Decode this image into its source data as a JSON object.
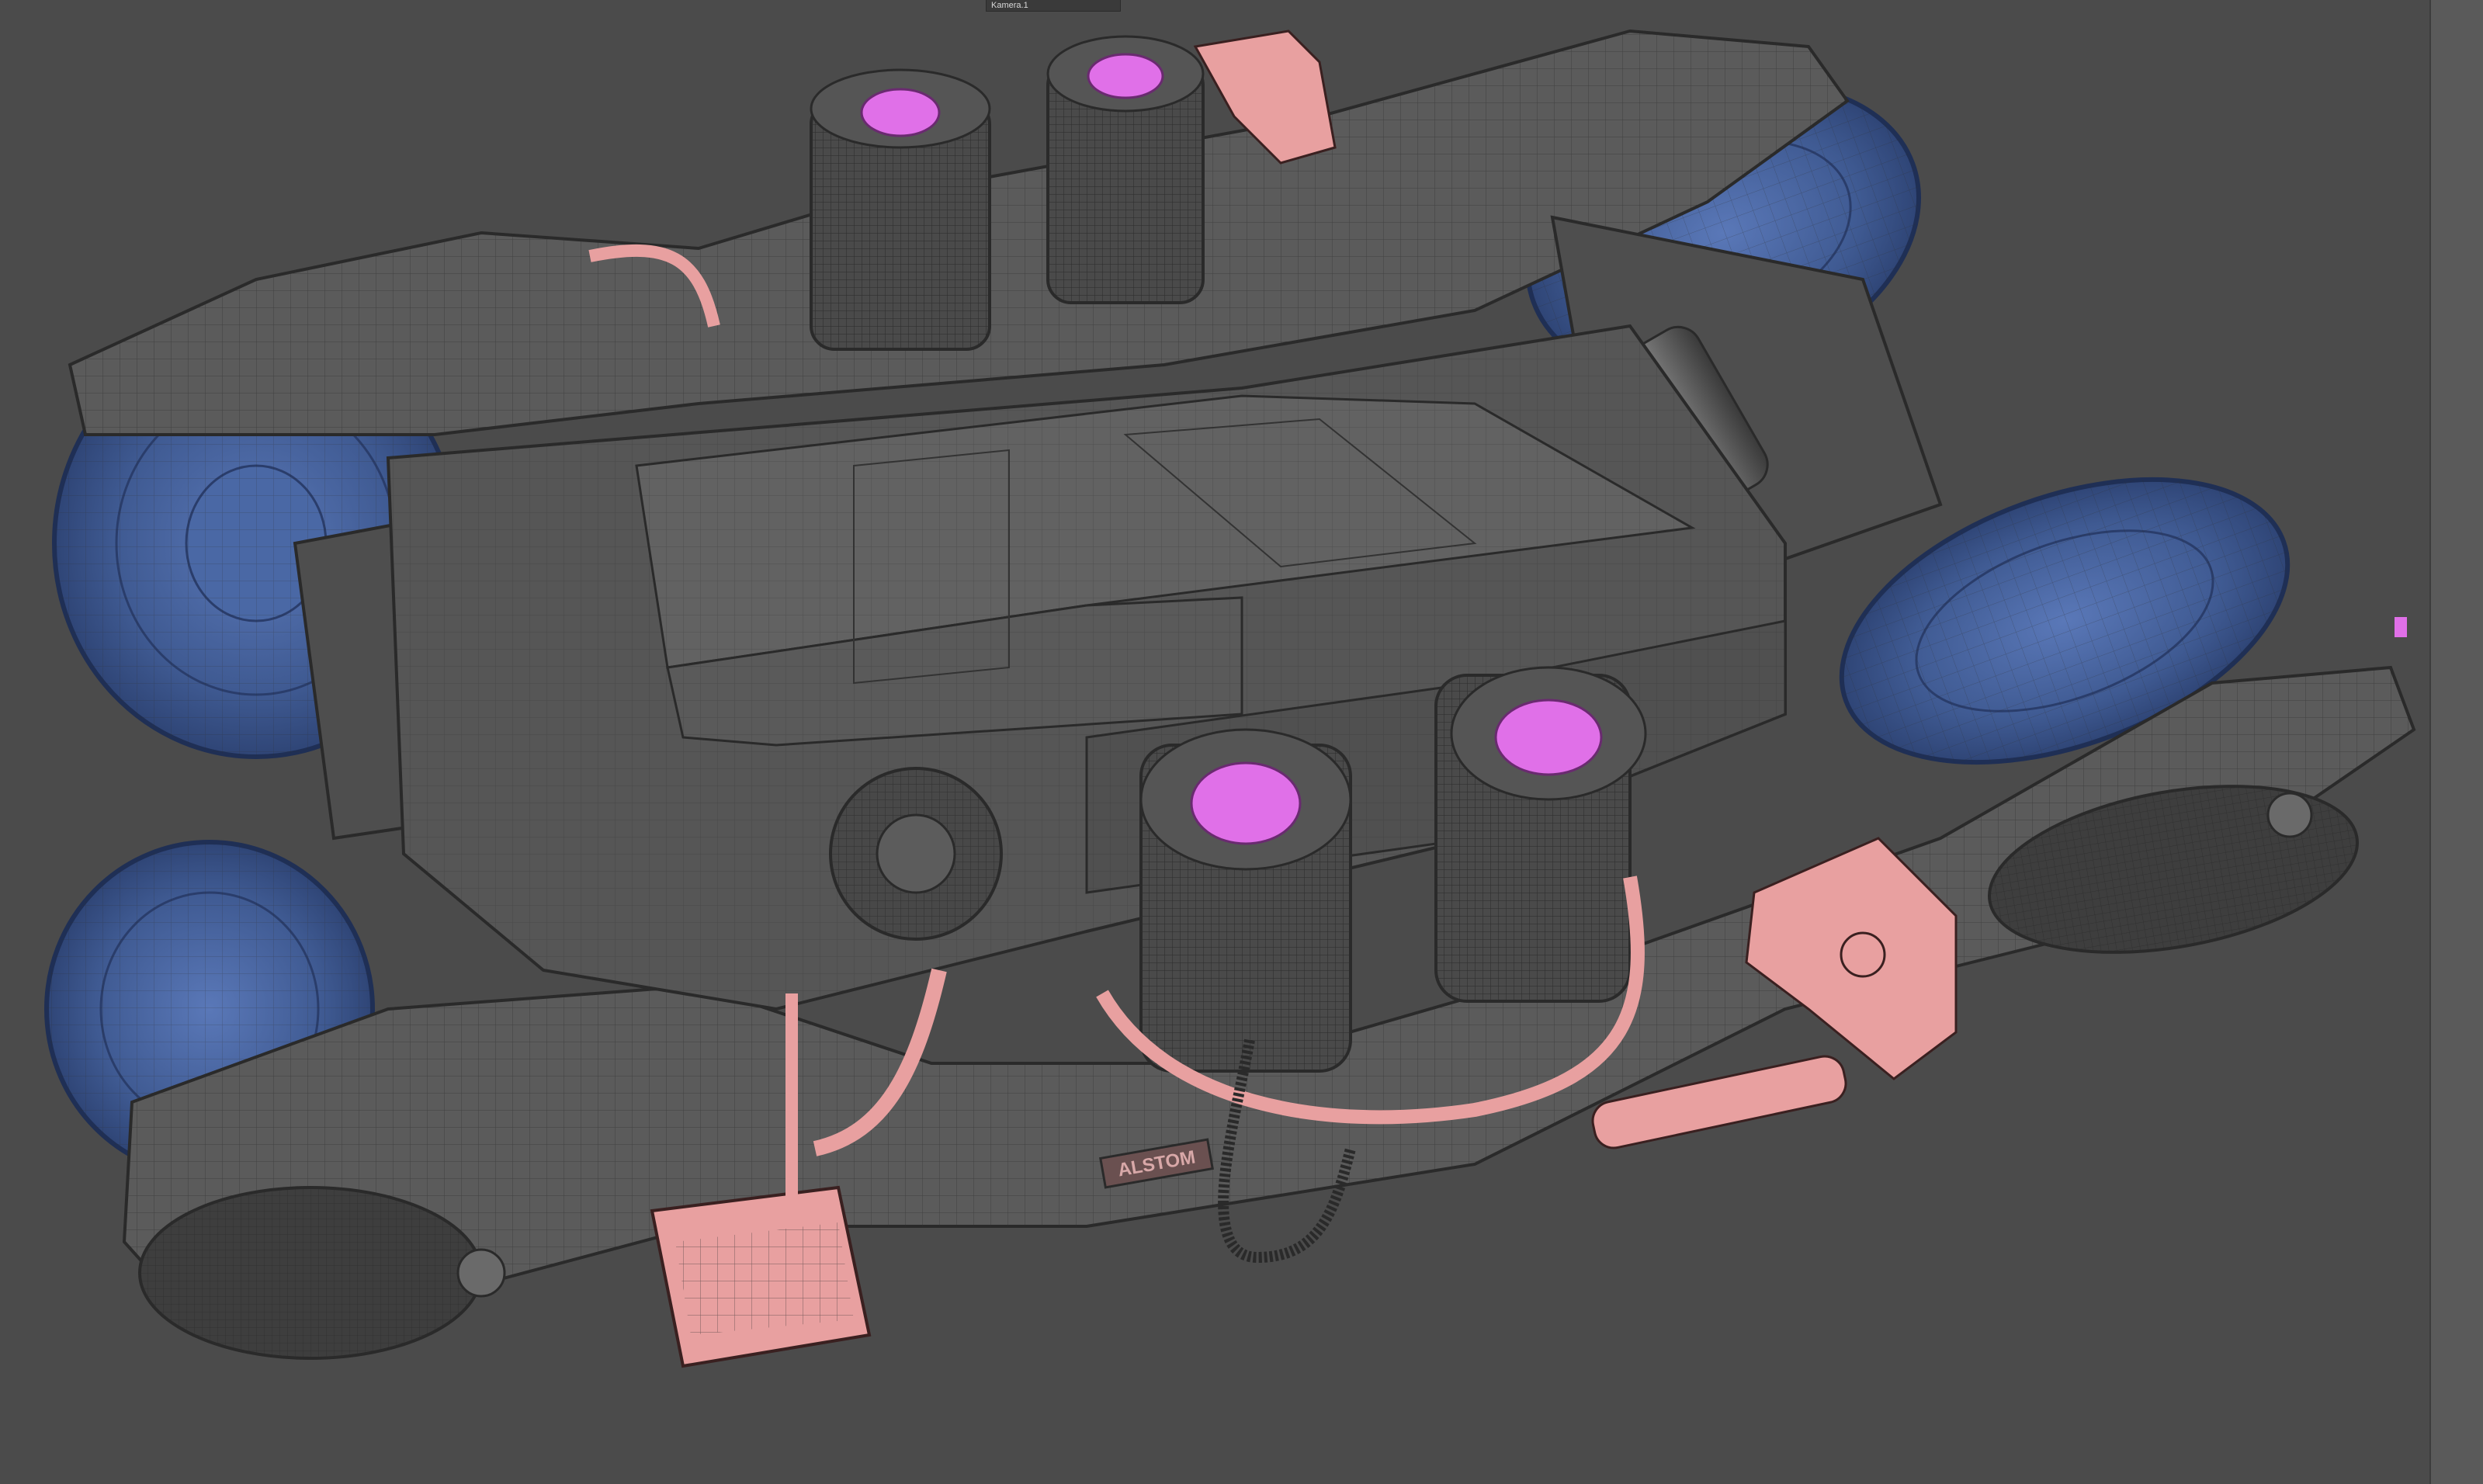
{
  "viewport": {
    "camera_label": "Kamera.1",
    "background_color": "#4b4b4b"
  },
  "model": {
    "brand_plate_text": "ALSTOM",
    "colors": {
      "body": "#5b5b5b",
      "body_dark": "#424242",
      "wheel": "#3f5a92",
      "wheel_light": "#5874ad",
      "air_spring_top": "#e070e8",
      "accent_pink": "#e8a0a0",
      "wire": "#2a2a2a"
    }
  }
}
